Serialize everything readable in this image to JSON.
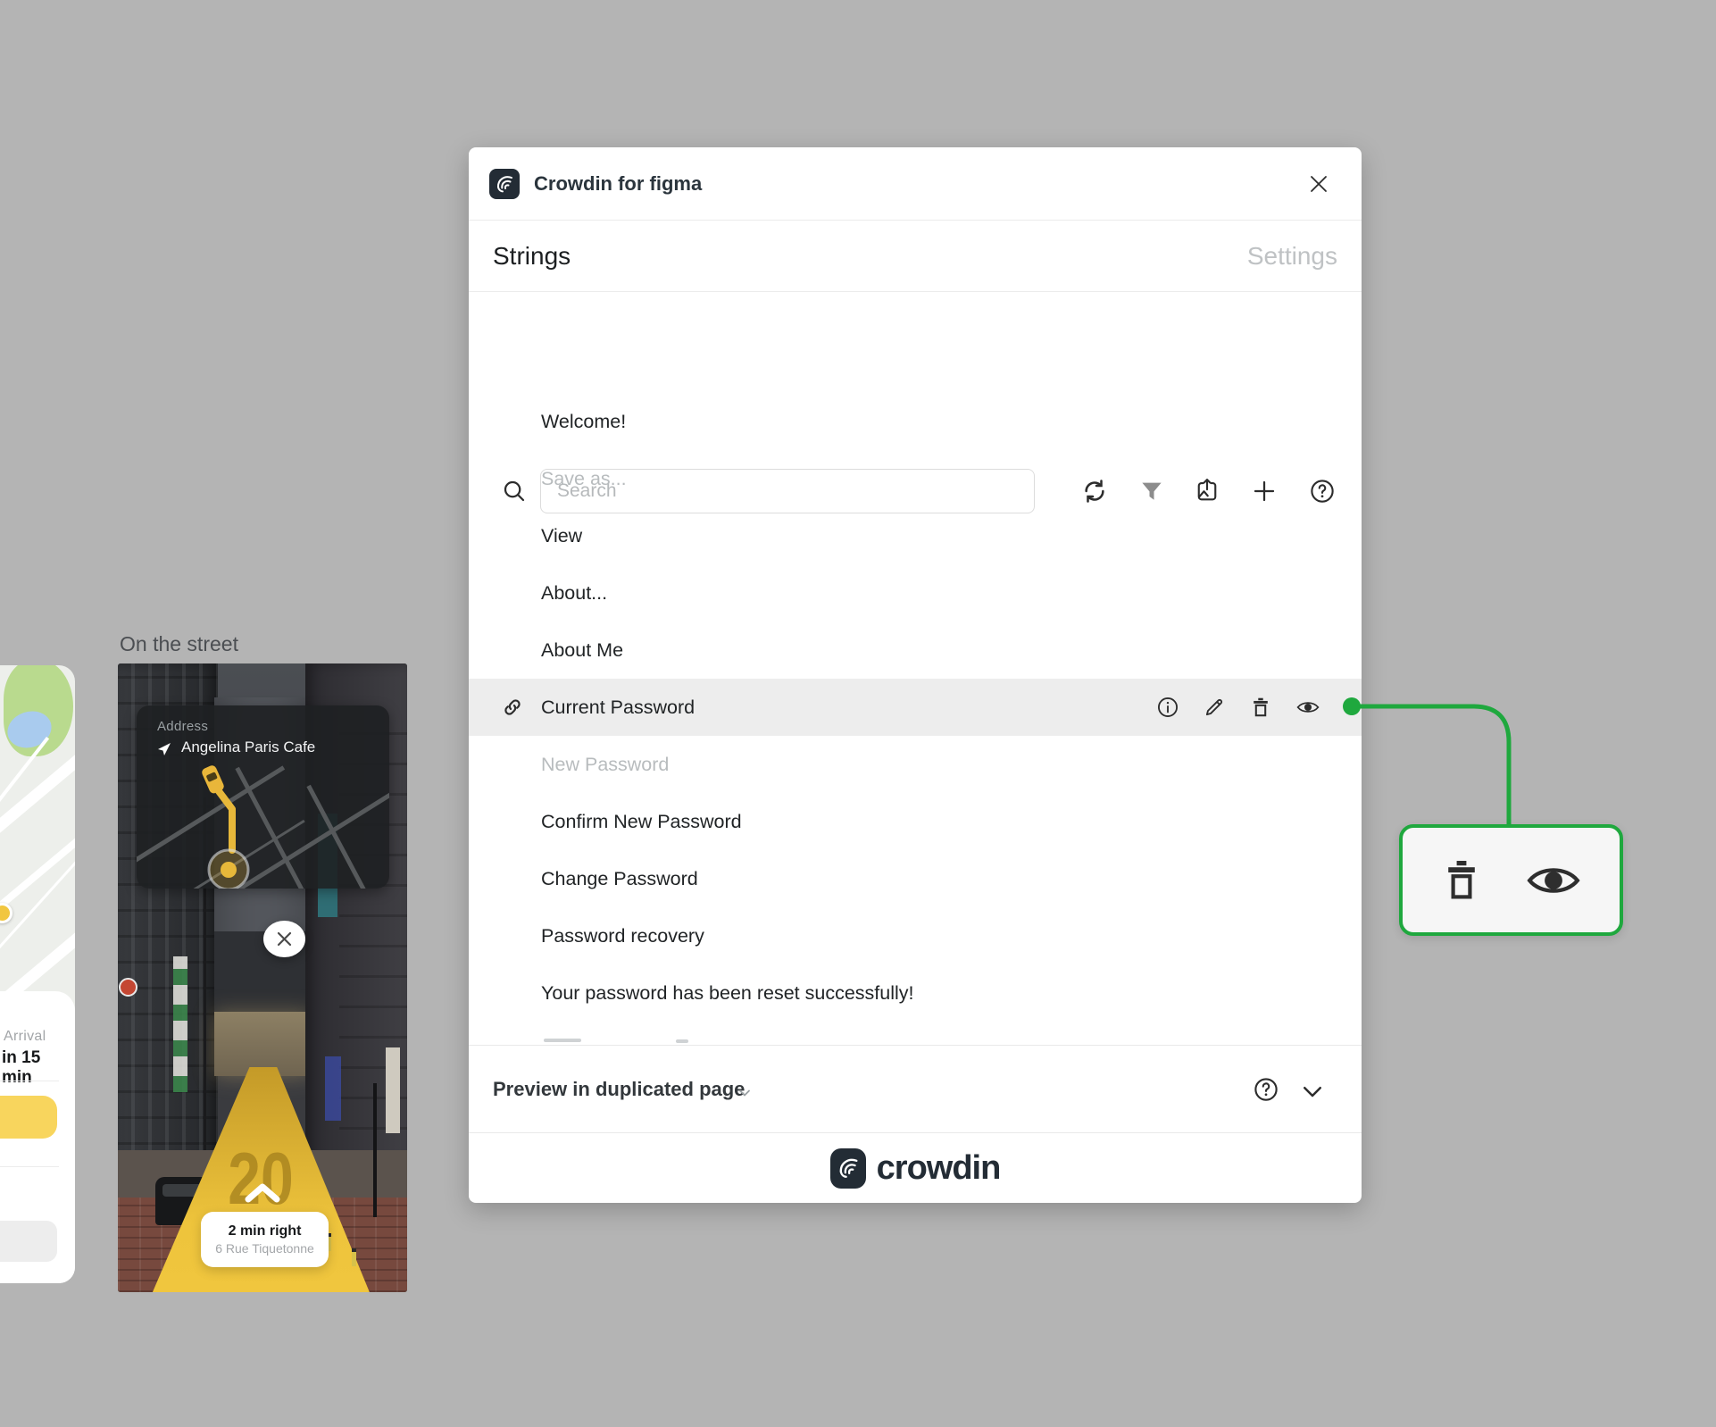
{
  "canvas": {
    "background": "#b4b4b4",
    "accent_green": "#1fa83e"
  },
  "plugin": {
    "title": "Crowdin for figma",
    "tabs": {
      "strings": "Strings",
      "settings": "Settings"
    },
    "search": {
      "placeholder": "Search"
    },
    "toolbar_icons": [
      "sync-icon",
      "filter-icon",
      "preview-frames-icon",
      "add-icon",
      "help-icon"
    ],
    "strings": [
      {
        "label": "Welcome!"
      },
      {
        "label": "Save as...",
        "muted": true
      },
      {
        "label": "View"
      },
      {
        "label": "About..."
      },
      {
        "label": "About Me"
      },
      {
        "label": "Current Password",
        "selected": true,
        "row_icons": [
          "info-icon",
          "edit-icon",
          "delete-icon",
          "preview-icon"
        ]
      },
      {
        "label": "New Password",
        "muted": true
      },
      {
        "label": "Confirm New Password"
      },
      {
        "label": "Change Password"
      },
      {
        "label": "Password recovery"
      },
      {
        "label": "Your password has been reset successfully!"
      }
    ],
    "footer": {
      "preview_label": "Preview in duplicated page"
    },
    "brand": {
      "wordmark": "crowdin",
      "color": "#232c35"
    }
  },
  "callout": {
    "icons": [
      "delete-icon",
      "preview-icon"
    ],
    "border_color": "#1fa83e"
  },
  "artboards": {
    "map": {
      "arrival_label": "Arrival",
      "arrival_value": "in 15 min",
      "button_color": "#f8d55d"
    },
    "street": {
      "title": "On the street",
      "address_label": "Address",
      "address_value": "Angelina Paris Cafe",
      "path_number": "20",
      "direction_primary": "2 min right",
      "direction_secondary": "6 Rue Tiquetonne",
      "path_color": "#eec43c"
    }
  }
}
